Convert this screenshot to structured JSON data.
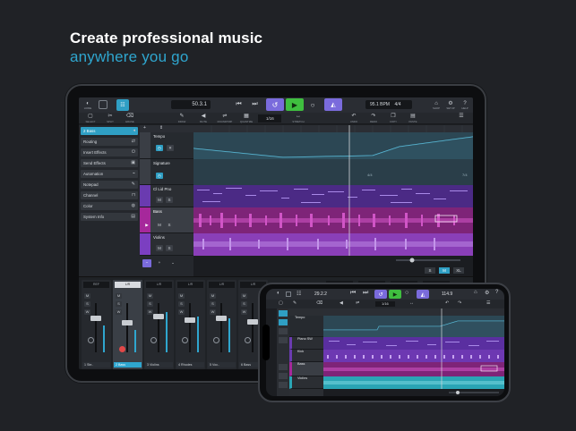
{
  "headline": {
    "title": "Create professional music",
    "subtitle": "anywhere you go"
  },
  "colors": {
    "accent": "#2fa6cf",
    "purple": "#7b3fc1",
    "magenta": "#a6289b",
    "teal": "#2aa5b5",
    "play_green": "#3fbf3f",
    "loop_purple": "#7a6bdc"
  },
  "tablet": {
    "toolbar": {
      "home_label": "HOME",
      "position": "50.3.1",
      "bpm": "95.1 BPM",
      "signature": "4/4",
      "shop_label": "SHOP",
      "setup_label": "SETUP",
      "help_label": "HELP"
    },
    "tools": [
      "SELECT",
      "SPLIT",
      "ERASE",
      "DRAW",
      "MUTE",
      "ROUNDTRIP",
      "QUANTIZE",
      "STRETCH",
      "UNDO",
      "REDO",
      "COPY",
      "PASTE"
    ],
    "quantize": "1/16",
    "inspector": {
      "track_name": "2 Bass",
      "rows": [
        "Routing",
        "Insert Effects",
        "Send Effects",
        "Automation",
        "Notepad",
        "Channel",
        "Color",
        "System Info"
      ]
    },
    "tracks": [
      {
        "name": "Tempo"
      },
      {
        "name": "Signature"
      },
      {
        "name": "Cl Lid Pno"
      },
      {
        "name": "Bass"
      },
      {
        "name": "Violins"
      }
    ],
    "signature_events": [
      "4/4",
      "7/4"
    ],
    "zoom_buttons": [
      "S",
      "M",
      "XL"
    ],
    "mixer": {
      "channels": [
        {
          "top": "REF",
          "pan": "<C>"
        },
        {
          "top": "L/R",
          "pan": "C"
        },
        {
          "top": "L/R",
          "pan": "L/R"
        },
        {
          "top": "L/R",
          "pan": "L/R"
        },
        {
          "top": "L/R",
          "pan": "L/R"
        },
        {
          "top": "L/R",
          "pan": "L/R"
        }
      ],
      "names": [
        "1 Ste..",
        "2 Bass",
        "3 Violins",
        "4 Rhodes",
        "5 Voc..",
        "6 Bass"
      ]
    }
  },
  "phone": {
    "position": "29.2.2",
    "bpm": "114.9",
    "quantize": "1/16",
    "tracks": [
      "Tempo",
      "Piano SW",
      "Kick",
      "Bass",
      "Violins"
    ]
  }
}
